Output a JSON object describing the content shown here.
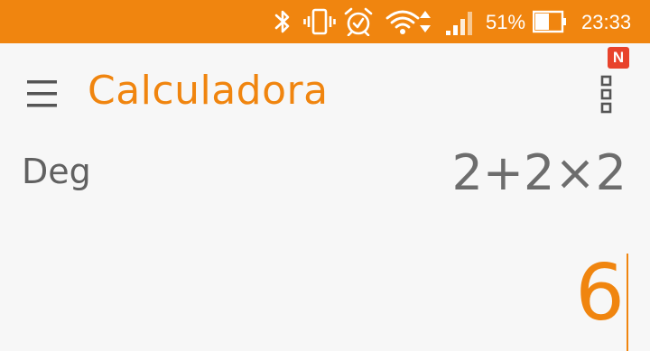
{
  "status_bar": {
    "battery_percent": "51%",
    "time": "23:33",
    "background_color": "#f0850f",
    "icons": [
      "bluetooth-icon",
      "vibrate-icon",
      "alarm-icon",
      "wifi-icon",
      "signal-icon",
      "battery-icon"
    ]
  },
  "app_bar": {
    "title": "Calculadora",
    "menu_icon": "menu-icon",
    "overflow_icon": "overflow-menu-icon",
    "notification_badge": "N",
    "accent_color": "#f0850f"
  },
  "display": {
    "angle_mode": "Deg",
    "expression": "2+2×2",
    "result": "6"
  }
}
